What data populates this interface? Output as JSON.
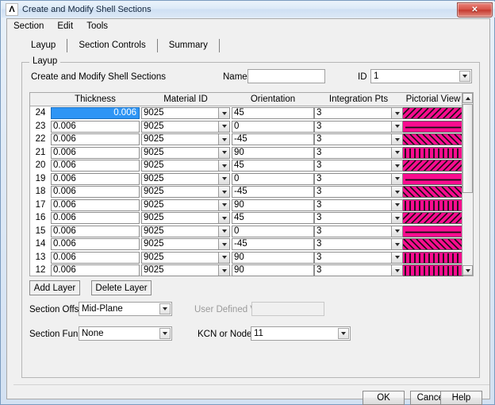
{
  "window": {
    "title": "Create and Modify Shell Sections",
    "icon": "ansys-lambda-icon",
    "close_label": "✕"
  },
  "menu": {
    "items": [
      {
        "label": "Section"
      },
      {
        "label": "Edit"
      },
      {
        "label": "Tools"
      }
    ]
  },
  "tabs": {
    "items": [
      {
        "label": "Layup",
        "active": true
      },
      {
        "label": "Section Controls",
        "active": false
      },
      {
        "label": "Summary",
        "active": false
      }
    ]
  },
  "group": {
    "title": "Layup",
    "heading": "Create and Modify Shell Sections",
    "name_label": "Name",
    "name_value": "",
    "id_label": "ID",
    "id_value": "1"
  },
  "table": {
    "columns": [
      {
        "key": "thickness",
        "label": "Thickness"
      },
      {
        "key": "material_id",
        "label": "Material ID"
      },
      {
        "key": "orientation",
        "label": "Orientation"
      },
      {
        "key": "integration_pts",
        "label": "Integration Pts"
      },
      {
        "key": "pictorial",
        "label": "Pictorial View"
      }
    ],
    "selected_row": 0,
    "rows": [
      {
        "n": "24",
        "thickness": "0.006",
        "material_id": "9025",
        "orientation": "45",
        "integration_pts": "3",
        "pattern": "diag-forward"
      },
      {
        "n": "23",
        "thickness": "0.006",
        "material_id": "9025",
        "orientation": "0",
        "integration_pts": "3",
        "pattern": "horizontal"
      },
      {
        "n": "22",
        "thickness": "0.006",
        "material_id": "9025",
        "orientation": "-45",
        "integration_pts": "3",
        "pattern": "diag-back"
      },
      {
        "n": "21",
        "thickness": "0.006",
        "material_id": "9025",
        "orientation": "90",
        "integration_pts": "3",
        "pattern": "vertical"
      },
      {
        "n": "20",
        "thickness": "0.006",
        "material_id": "9025",
        "orientation": "45",
        "integration_pts": "3",
        "pattern": "diag-forward"
      },
      {
        "n": "19",
        "thickness": "0.006",
        "material_id": "9025",
        "orientation": "0",
        "integration_pts": "3",
        "pattern": "horizontal"
      },
      {
        "n": "18",
        "thickness": "0.006",
        "material_id": "9025",
        "orientation": "-45",
        "integration_pts": "3",
        "pattern": "diag-back"
      },
      {
        "n": "17",
        "thickness": "0.006",
        "material_id": "9025",
        "orientation": "90",
        "integration_pts": "3",
        "pattern": "vertical"
      },
      {
        "n": "16",
        "thickness": "0.006",
        "material_id": "9025",
        "orientation": "45",
        "integration_pts": "3",
        "pattern": "diag-forward"
      },
      {
        "n": "15",
        "thickness": "0.006",
        "material_id": "9025",
        "orientation": "0",
        "integration_pts": "3",
        "pattern": "horizontal"
      },
      {
        "n": "14",
        "thickness": "0.006",
        "material_id": "9025",
        "orientation": "-45",
        "integration_pts": "3",
        "pattern": "diag-back"
      },
      {
        "n": "13",
        "thickness": "0.006",
        "material_id": "9025",
        "orientation": "90",
        "integration_pts": "3",
        "pattern": "vertical"
      },
      {
        "n": "12",
        "thickness": "0.006",
        "material_id": "9025",
        "orientation": "90",
        "integration_pts": "3",
        "pattern": "vertical"
      }
    ]
  },
  "layer_actions": {
    "add_label": "Add Layer",
    "delete_label": "Delete Layer"
  },
  "offset": {
    "label": "Section Offs",
    "value": "Mid-Plane",
    "udv_label": "User Defined Value",
    "udv_value": ""
  },
  "function": {
    "label": "Section Fun",
    "value": "None",
    "kcn_label": "KCN or Node",
    "kcn_value": "11"
  },
  "footer": {
    "ok_label": "OK",
    "cancel_label": "Cancel",
    "help_label": "Help"
  },
  "colors": {
    "pictorial_bg": "#fa0c8f",
    "pictorial_ink": "#111111",
    "selection": "#2e95f5",
    "titlebar": "#dce9f7",
    "close_button": "#c53a2f"
  }
}
